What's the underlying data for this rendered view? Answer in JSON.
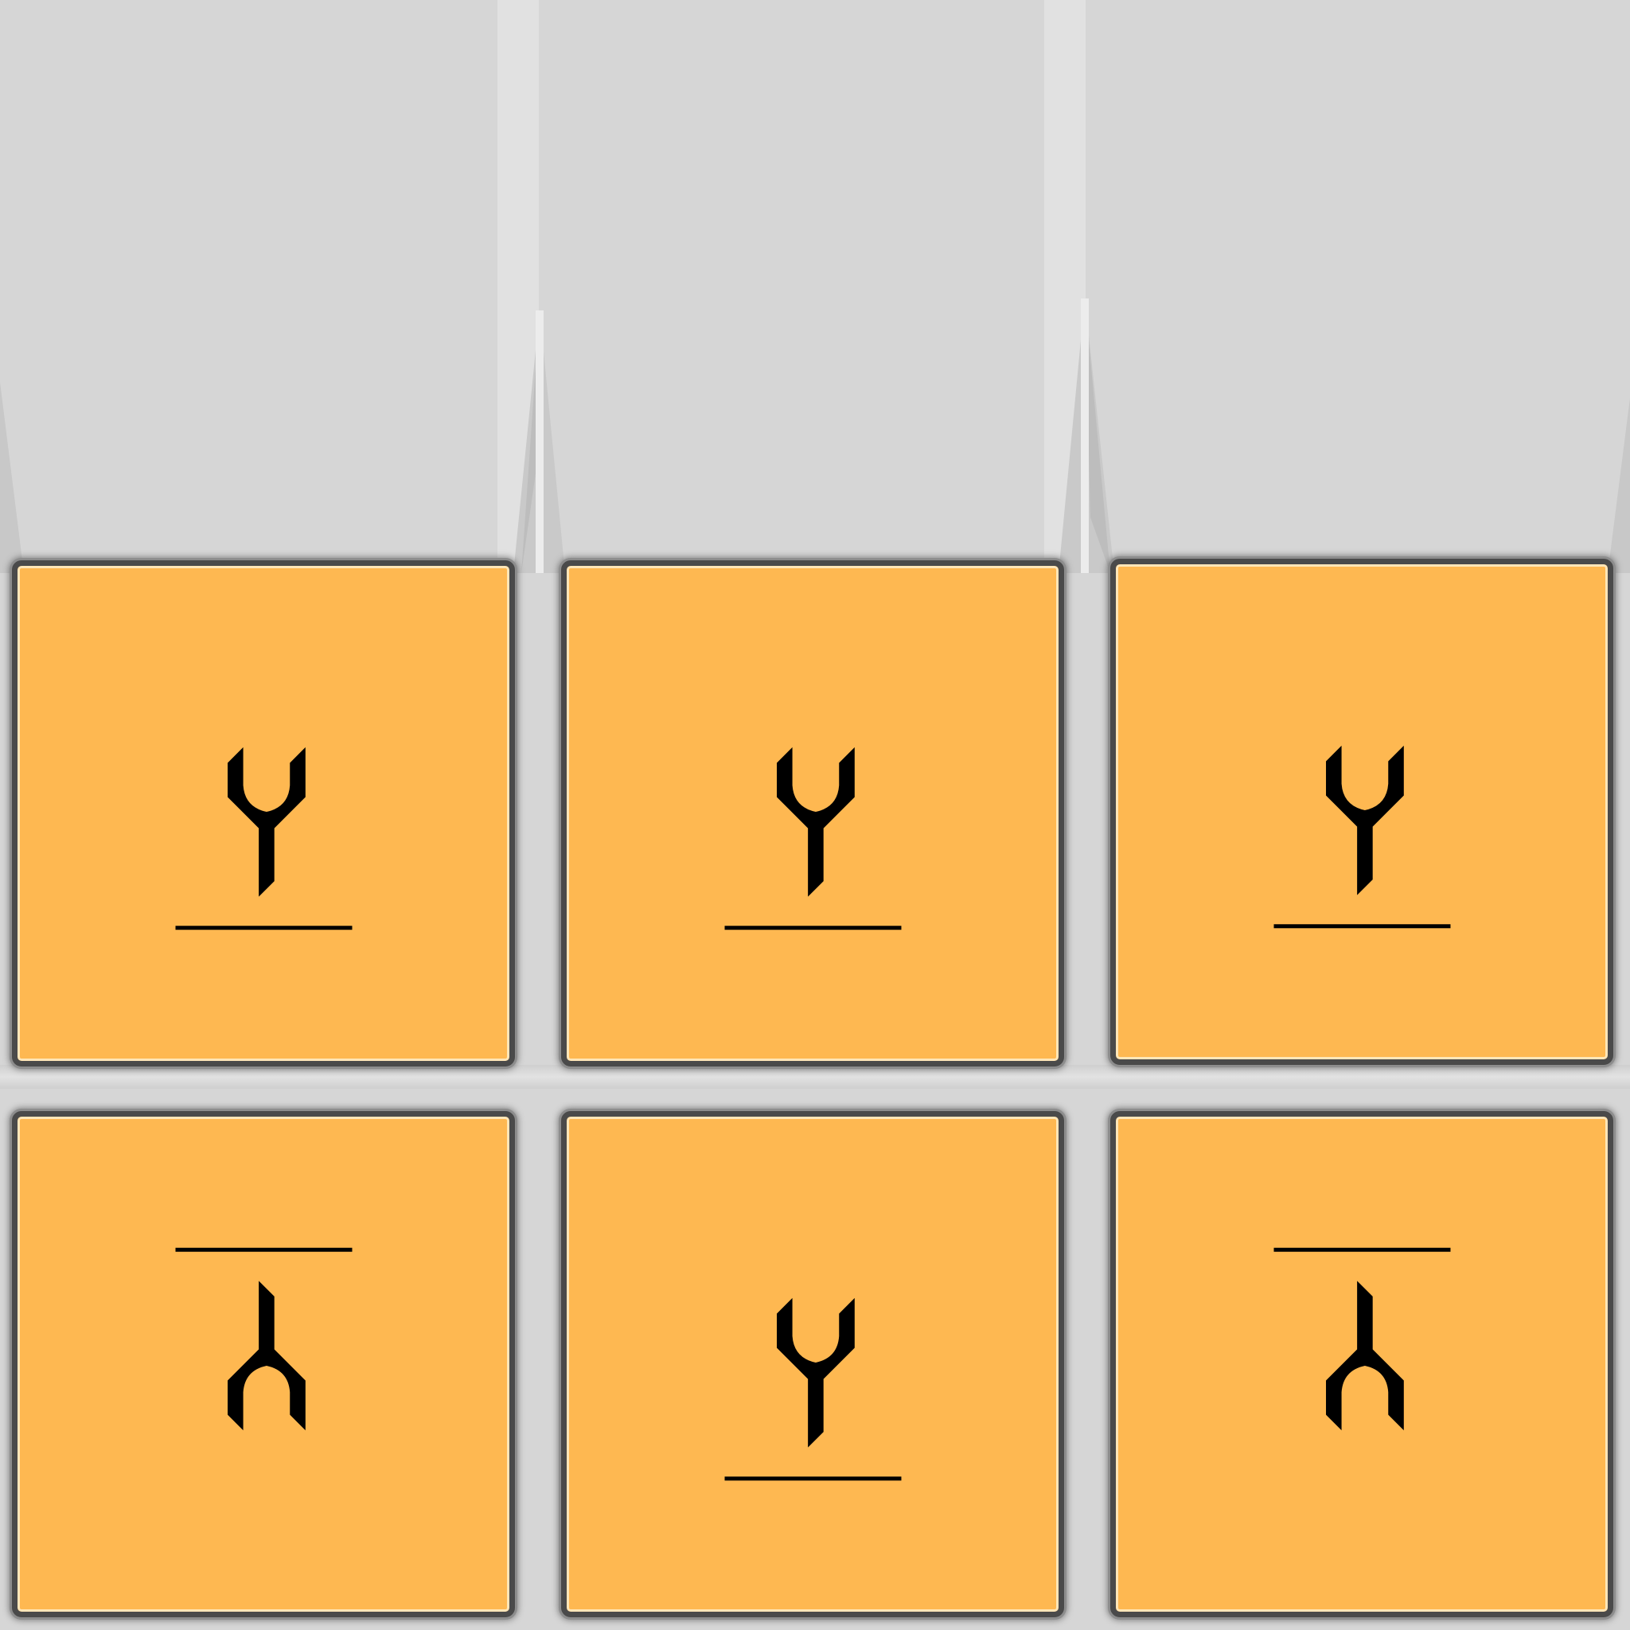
{
  "board": {
    "columns": 3,
    "rows_of_tiles": 2,
    "tile_color": "#feb851",
    "tile_border_color": "#4a4a4a",
    "background_color": "#d6d6d6"
  },
  "tiles": [
    {
      "row": 1,
      "col": 1,
      "symbol": "fork-up-with-baseline-icon",
      "orientation": "upright"
    },
    {
      "row": 1,
      "col": 2,
      "symbol": "fork-up-with-baseline-icon",
      "orientation": "upright"
    },
    {
      "row": 1,
      "col": 3,
      "symbol": "fork-up-with-baseline-icon",
      "orientation": "upright"
    },
    {
      "row": 2,
      "col": 1,
      "symbol": "fork-down-with-topline-icon",
      "orientation": "flipped"
    },
    {
      "row": 2,
      "col": 2,
      "symbol": "fork-up-with-baseline-icon",
      "orientation": "upright"
    },
    {
      "row": 2,
      "col": 3,
      "symbol": "fork-down-with-topline-icon",
      "orientation": "flipped"
    }
  ]
}
